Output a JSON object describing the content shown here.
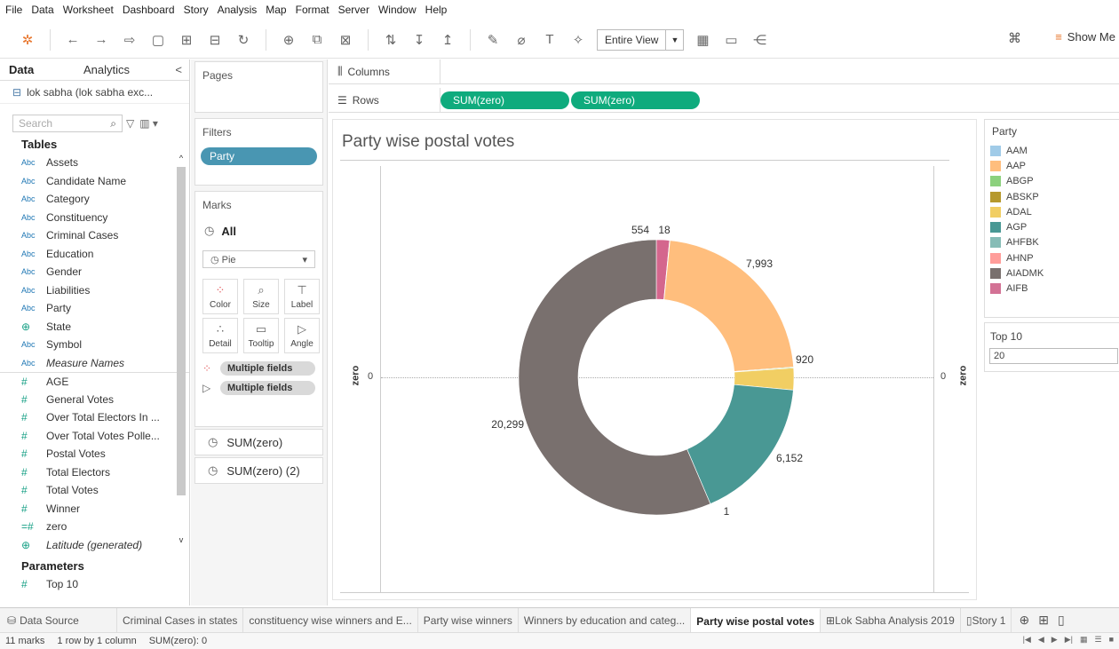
{
  "menu": [
    "File",
    "Data",
    "Worksheet",
    "Dashboard",
    "Story",
    "Analysis",
    "Map",
    "Format",
    "Server",
    "Window",
    "Help"
  ],
  "toolbar": {
    "view_size": "Entire View",
    "show_me_label": "Show Me",
    "icons": [
      "tableau-logo-icon",
      "undo-icon",
      "redo-icon",
      "pause-icon",
      "save-icon",
      "new-datasource-icon",
      "datasource-dropdown-icon",
      "refresh-icon",
      "new-worksheet-icon",
      "duplicate-icon",
      "clear-sheet-icon",
      "swap-icon",
      "sort-asc-icon",
      "sort-desc-icon",
      "highlight-icon",
      "group-icon",
      "label-icon",
      "pin-icon",
      "fit-icon",
      "presentation-icon",
      "share-icon",
      "binoculars-icon"
    ]
  },
  "datapane": {
    "tab_data": "Data",
    "tab_analytics": "Analytics",
    "collapse": "<",
    "datasource": "lok sabha (lok sabha exc...",
    "search_placeholder": "Search",
    "tables_heading": "Tables",
    "fields": [
      {
        "type": "Abc",
        "name": "Assets"
      },
      {
        "type": "Abc",
        "name": "Candidate Name"
      },
      {
        "type": "Abc",
        "name": "Category"
      },
      {
        "type": "Abc",
        "name": "Constituency"
      },
      {
        "type": "Abc",
        "name": "Criminal Cases"
      },
      {
        "type": "Abc",
        "name": "Education"
      },
      {
        "type": "Abc",
        "name": "Gender"
      },
      {
        "type": "Abc",
        "name": "Liabilities"
      },
      {
        "type": "Abc",
        "name": "Party"
      },
      {
        "type": "⊕",
        "name": "State"
      },
      {
        "type": "Abc",
        "name": "Symbol"
      },
      {
        "type": "Abc",
        "name": "Measure Names"
      }
    ],
    "measures": [
      {
        "type": "#",
        "name": "AGE"
      },
      {
        "type": "#",
        "name": "General Votes"
      },
      {
        "type": "#",
        "name": "Over Total Electors In ..."
      },
      {
        "type": "#",
        "name": "Over Total Votes Polle..."
      },
      {
        "type": "#",
        "name": "Postal Votes"
      },
      {
        "type": "#",
        "name": "Total Electors"
      },
      {
        "type": "#",
        "name": "Total Votes"
      },
      {
        "type": "#",
        "name": "Winner"
      },
      {
        "type": "=#",
        "name": "zero"
      },
      {
        "type": "⊕",
        "name": "Latitude (generated)"
      }
    ],
    "parameters_heading": "Parameters",
    "parameter": {
      "type": "#",
      "name": "Top 10"
    }
  },
  "shelves": {
    "pages": "Pages",
    "filters": "Filters",
    "filter_pill": "Party",
    "marks": "Marks",
    "marks_all": "All",
    "mark_type": "Pie",
    "mark_buttons": [
      "Color",
      "Size",
      "Label",
      "Detail",
      "Tooltip",
      "Angle"
    ],
    "multiple_fields_1": "Multiple fields",
    "multiple_fields_2": "Multiple fields",
    "sum1": "SUM(zero)",
    "sum2": "SUM(zero) (2)",
    "columns_label": "Columns",
    "rows_label": "Rows",
    "rows_pills": [
      "SUM(zero)",
      "SUM(zero)"
    ]
  },
  "view": {
    "title": "Party wise postal votes",
    "left_axis_title": "zero",
    "right_axis_title": "zero",
    "left_zero": "0",
    "right_zero": "0"
  },
  "chart_data": {
    "type": "pie",
    "subtype": "donut",
    "title": "Party wise postal votes",
    "slices": [
      {
        "party": "AIFB",
        "label": "554",
        "value": 554,
        "color": "#d4668d"
      },
      {
        "party": "AAM",
        "label": "18",
        "value": 18,
        "color": "#a0cbe8"
      },
      {
        "party": "AAP",
        "label": "7,993",
        "value": 7993,
        "color": "#ffbe7d"
      },
      {
        "party": "ABGP",
        "label": "",
        "value": 40,
        "color": "#8cd17d"
      },
      {
        "party": "ADAL",
        "label": "920",
        "value": 920,
        "color": "#f1ce63"
      },
      {
        "party": "AGP",
        "label": "6,152",
        "value": 6152,
        "color": "#499894"
      },
      {
        "party": "AHFBK",
        "label": "1",
        "value": 1,
        "color": "#86bcb6"
      },
      {
        "party": "AIADMK",
        "label": "20,299",
        "value": 20299,
        "color": "#79706e"
      }
    ]
  },
  "legend": {
    "title": "Party",
    "items": [
      {
        "name": "AAM",
        "color": "#a0cbe8"
      },
      {
        "name": "AAP",
        "color": "#ffbe7d"
      },
      {
        "name": "ABGP",
        "color": "#8cd17d"
      },
      {
        "name": "ABSKP",
        "color": "#b6992d"
      },
      {
        "name": "ADAL",
        "color": "#f1ce63"
      },
      {
        "name": "AGP",
        "color": "#499894"
      },
      {
        "name": "AHFBK",
        "color": "#86bcb6"
      },
      {
        "name": "AHNP",
        "color": "#ff9d9a"
      },
      {
        "name": "AIADMK",
        "color": "#79706e"
      },
      {
        "name": "AIFB",
        "color": "#d37295"
      }
    ]
  },
  "parameter_control": {
    "title": "Top 10",
    "value": "20"
  },
  "sheet_tabs": {
    "data_source": "Data Source",
    "tabs": [
      "Criminal Cases in states",
      "constituency wise winners and E...",
      "Party wise winners",
      "Winners by education and categ...",
      "Party wise postal votes",
      "Lok Sabha Analysis 2019",
      "Story 1"
    ],
    "active": "Party wise postal votes"
  },
  "status": {
    "marks": "11 marks",
    "rows_cols": "1 row by 1 column",
    "sum": "SUM(zero): 0"
  }
}
